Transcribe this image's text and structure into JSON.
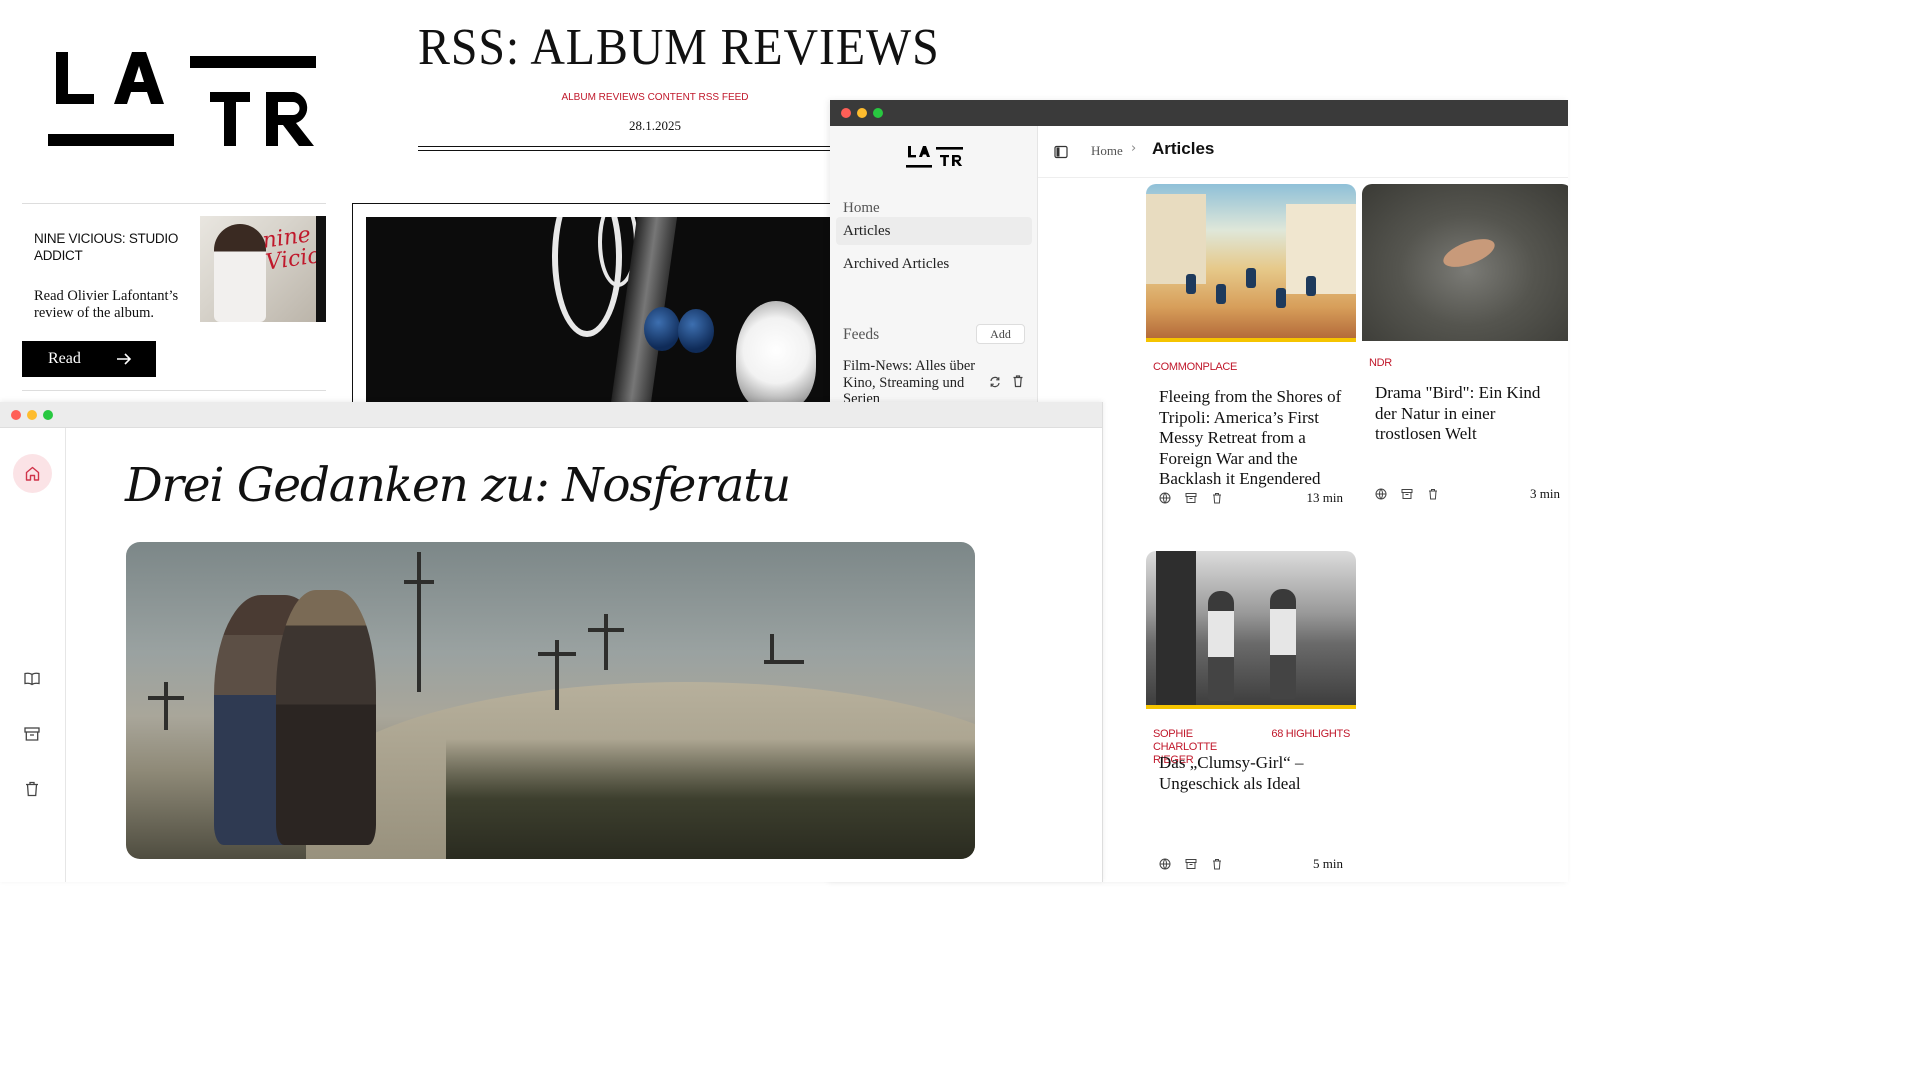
{
  "site": {
    "logo_text": "LATR",
    "page_title": "RSS: ALBUM REVIEWS",
    "subtitle": "ALBUM REVIEWS CONTENT RSS FEED",
    "date": "28.1.2025",
    "review": {
      "title": "NINE VICIOUS: STUDIO ADDICT",
      "text": "Read Olivier Lafontant’s review of the album.",
      "image_graffiti": "nine Viciou",
      "read_label": "Read",
      "read_icon": "arrow-right-icon"
    }
  },
  "app_window": {
    "logo_text": "LATR",
    "nav": {
      "home": "Home",
      "articles": "Articles",
      "archived": "Archived Articles"
    },
    "feeds_label": "Feeds",
    "add_label": "Add",
    "feeds": [
      {
        "name": "Film-News: Alles über Kino, Streaming und Serien",
        "icons": [
          "refresh-icon",
          "trash-icon"
        ]
      }
    ],
    "breadcrumb": {
      "home": "Home",
      "separator": "›",
      "current": "Articles"
    },
    "cards": [
      {
        "source": "COMMONPLACE",
        "highlights": "",
        "title": "Fleeing from the Shores of Tripoli: America’s First Messy Retreat from a Foreign War and the Backlash it Engendered",
        "read_time": "13 min"
      },
      {
        "source": "NDR",
        "highlights": "",
        "title": "Drama \"Bird\": Ein Kind der Natur in einer trostlosen Welt",
        "read_time": "3 min"
      },
      {
        "source": "SOPHIE CHARLOTTE RIEGER",
        "highlights": "68 HIGHLIGHTS",
        "title": "Das „Clumsy-Girl“ – Ungeschick als Ideal",
        "read_time": "5 min"
      }
    ],
    "card_actions": [
      "globe-icon",
      "archive-icon",
      "trash-icon"
    ]
  },
  "article_window": {
    "title": "Drei Gedanken zu: Nosferatu",
    "rail_icons": [
      "home-icon",
      "book-icon",
      "archive-icon",
      "trash-icon"
    ]
  },
  "colors": {
    "accent_red": "#c0182b",
    "highlight_yellow": "#f5c400",
    "dark_titlebar": "#3a3a3a",
    "home_active_bg": "#fbe3e6"
  }
}
